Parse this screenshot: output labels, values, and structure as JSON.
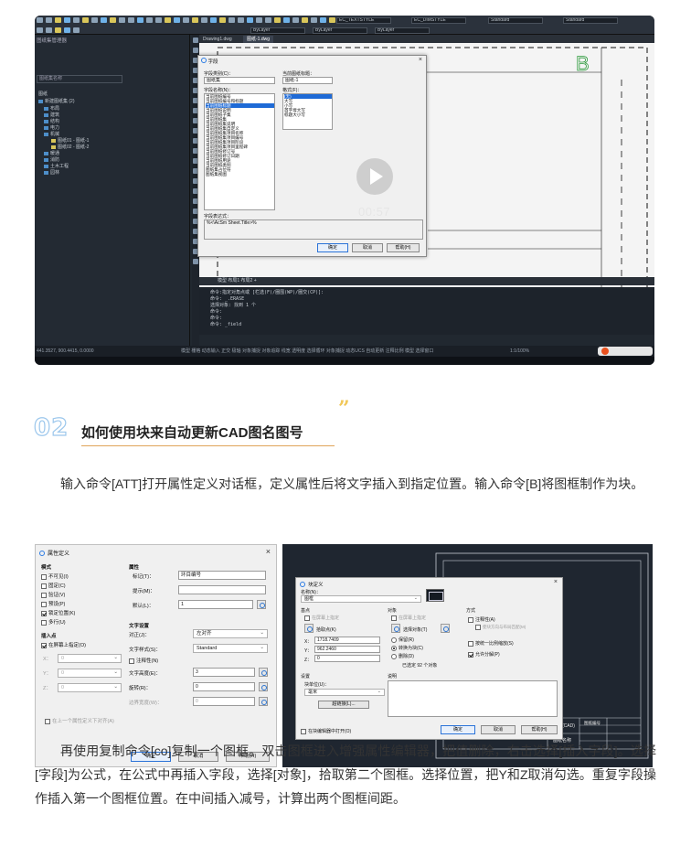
{
  "cad1": {
    "toolbar": {
      "text_style": "EC_TEXTSTYLE",
      "dim_style": "EC_DIMSTYLE",
      "table_style": "Standard",
      "mleader_style": "Standard",
      "layer_name": "ByLayer",
      "linetype": "ByLayer",
      "lineweight": "ByLayer"
    },
    "left_panel": {
      "title": "图纸集管理器",
      "search_placeholder": "图纸集名称",
      "tree": [
        "图纸",
        "新建图纸集 (2)",
        "布局",
        "建筑",
        "结构",
        "电力",
        "机械",
        "图纸01 - 图纸-1",
        "图纸02 - 图纸-2",
        "暖通",
        "消防",
        "土木工程",
        "园林"
      ]
    },
    "doc_tabs": [
      "Drawing1.dwg",
      "图纸-1.dwg"
    ],
    "field_dialog": {
      "title": "字段",
      "category_label": "字段类别(C)：",
      "category_value": "图纸集",
      "names_label": "字段名称(N)：",
      "names": [
        "当前图纸编号",
        "当前图纸编号和标题",
        "当前图纸标题",
        "当前图纸说明",
        "当前图纸子集",
        "当前图纸集",
        "当前图纸集说明",
        "当前图纸集自定义",
        "当前图纸集项目名称",
        "当前图纸集项目编号",
        "当前图纸集项目阶段",
        "当前图纸集项目里程碑",
        "当前图纸修订号",
        "当前图纸修订日期",
        "当前图纸用途",
        "当前图纸类别",
        "图纸集占位符",
        "图纸集视图"
      ],
      "selected_name": "当前图纸标题",
      "value_label": "当前图纸标题：",
      "value": "图纸-1",
      "format_label": "格式(F)：",
      "formats": [
        "(无)",
        "大写",
        "小写",
        "首字母大写",
        "标题大小写"
      ],
      "selected_format": "(无)",
      "expr_label": "字段表达式：",
      "expr_value": "%<\\AcSm Sheet.Title>%",
      "ok": "确定",
      "cancel": "取消",
      "help": "帮助(H)"
    },
    "video_time": "00:57",
    "model_tabs": "模型  布局1  布局2  +",
    "command_lines": [
      "命令:指定对角点或 [栏选(F)/圈围(WP)/圈交(CP)]:",
      "命令: _.ERASE",
      "选择对象: 找到 1 个",
      "命令:",
      "命令:",
      "命令: _field"
    ],
    "status_coords": "441.3527, 900.4415, 0.0000",
    "status_items": "模型 栅格 动态输入 正交 极轴 对象捕捉 对象追踪 线宽 透明度 选择循环 对象捕捉 动态UCS 自动更新 注释比例 模型 选择窗口",
    "zoom_value": "1:1/100%"
  },
  "section": {
    "number": "02",
    "title": "如何使用块来自动更新CAD图名图号",
    "quote": "”"
  },
  "para1": "输入命令[ATT]打开属性定义对话框，定义属性后将文字插入到指定位置。输入命令[B]将图框制作为块。",
  "att_dialog": {
    "title": "属性定义",
    "mode_label": "模式",
    "modes": [
      {
        "label": "不可见(I)",
        "checked": false
      },
      {
        "label": "固定(C)",
        "checked": false
      },
      {
        "label": "验证(V)",
        "checked": false
      },
      {
        "label": "预设(P)",
        "checked": false
      },
      {
        "label": "锁定位置(K)",
        "checked": true
      },
      {
        "label": "多行(U)",
        "checked": false
      }
    ],
    "insert_label": "插入点",
    "on_screen": "在屏幕上指定(O)",
    "xyz": [
      "X：",
      "Y：",
      "Z："
    ],
    "xyz_values": [
      "0",
      "0",
      "0"
    ],
    "attr_label": "属性",
    "tag_label": "标记(T)：",
    "tag_value": "环目编号",
    "prompt_label": "提示(M)：",
    "default_label": "默认(L)：",
    "default_value": "1",
    "text_label": "文字设置",
    "justify_label": "对正(J)：",
    "justify_value": "左对齐",
    "style_label": "文字样式(S)：",
    "style_value": "Standard",
    "annotative": "注释性(N)",
    "height_label": "文字高度(E)：",
    "height_value": "3",
    "rotation_label": "旋转(R)：",
    "rotation_value": "0",
    "width_label": "边界宽度(W)：",
    "width_value": "0",
    "align_below": "在上一个属性定义下对齐(A)",
    "ok": "确定",
    "cancel": "取消",
    "help": "帮助(H)"
  },
  "blk_dialog": {
    "title": "块定义",
    "name_label": "名称(N)：",
    "name_value": "图框",
    "base_label": "基点",
    "base_screen": "在屏幕上指定",
    "pick_point": "拾取点(K)",
    "x_value": "1718.7409",
    "y_value": "962.2460",
    "z_value": "0",
    "obj_label": "对象",
    "obj_screen": "在屏幕上指定",
    "select_objects": "选择对象(T)",
    "retain": "保留(R)",
    "convert": "转换为块(C)",
    "delete": "删除(D)",
    "selected_count": "已选定 92 个对象",
    "behavior_label": "方式",
    "annotative": "注释性(A)",
    "match_orient": "使块方向与布局匹配(M)",
    "uniform_scale": "按统一比例缩放(S)",
    "allow_explode": "允许分解(P)",
    "settings_label": "设置",
    "unit_label": "块单位(U)：",
    "unit_value": "毫米",
    "hyperlink": "超链接(L)...",
    "desc_label": "说明",
    "open_editor": "在块编辑器中打开(O)",
    "ok": "确定",
    "cancel": "取消",
    "help": "帮助(H)"
  },
  "title_block": {
    "cells": [
      "图纸(CAD)",
      "图纸名称",
      "图纸编号"
    ]
  },
  "para2": "再使用复制命令[co]复制一个图框。双击图框进入增强属性编辑器，把值删除，右击选择[插入字段]。选择[字段]为公式，在公式中再插入字段，选择[对象]，拾取第二个图框。选择位置，把Y和Z取消勾选。重复字段操作插入第一个图框位置。在中间插入减号，计算出两个图框间距。"
}
